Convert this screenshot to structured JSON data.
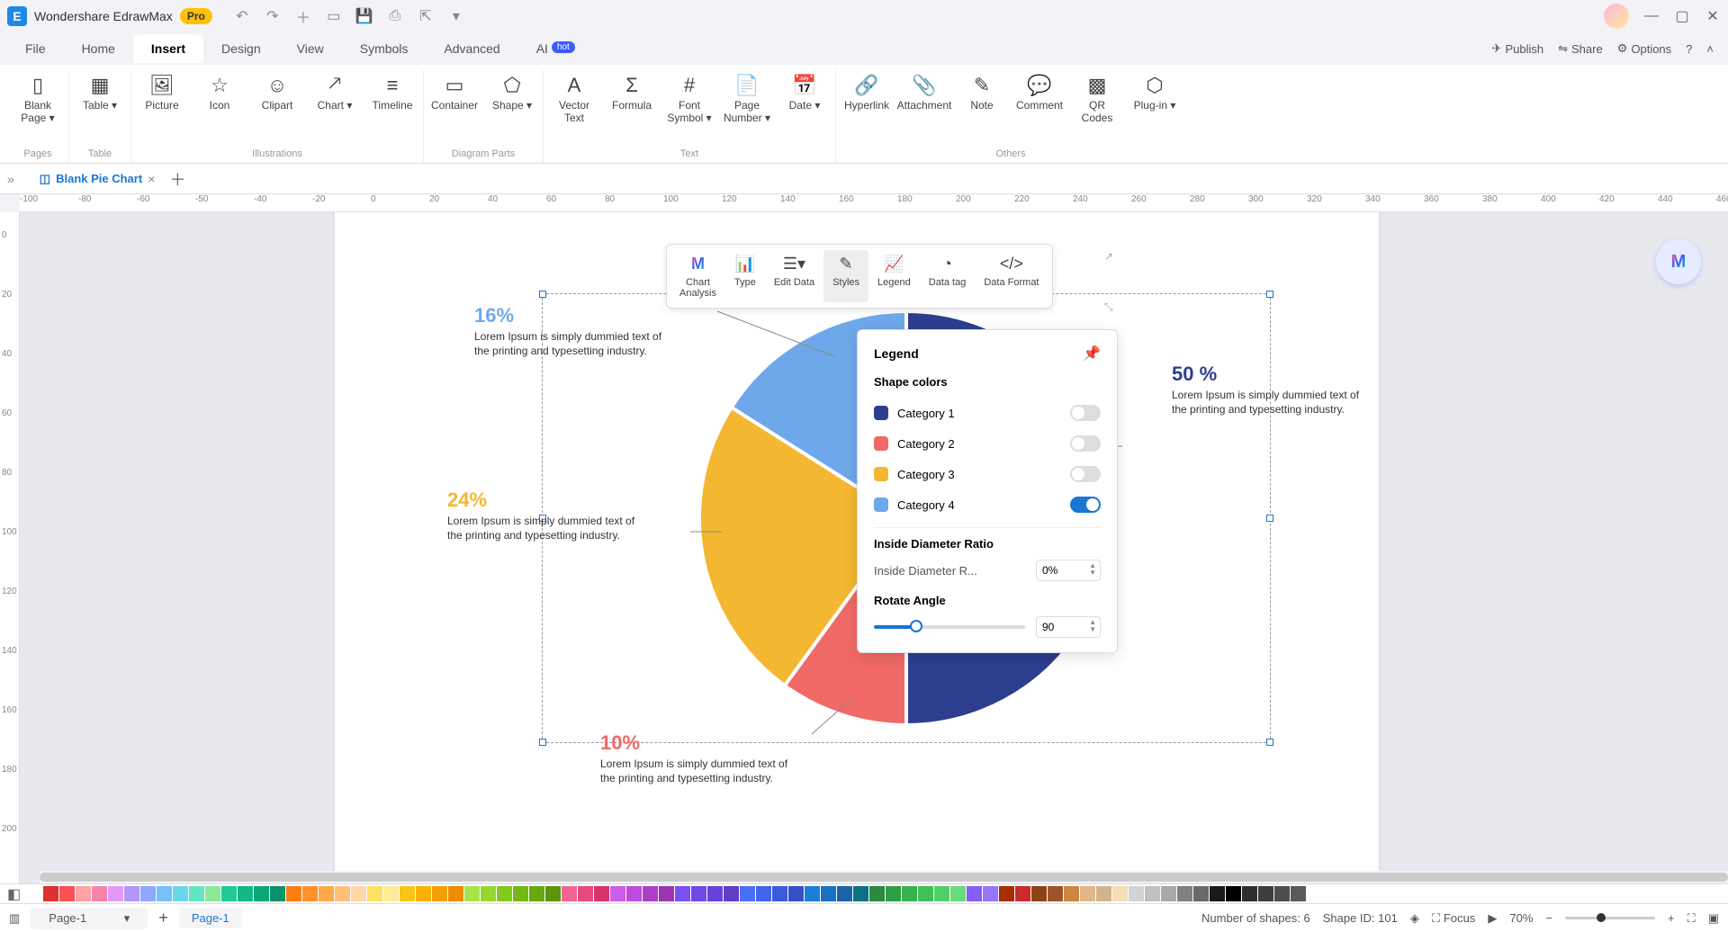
{
  "app": {
    "title": "Wondershare EdrawMax",
    "badge": "Pro"
  },
  "menu": {
    "tabs": [
      "File",
      "Home",
      "Insert",
      "Design",
      "View",
      "Symbols",
      "Advanced",
      "AI"
    ],
    "active": "Insert",
    "hot_on": "AI",
    "right": {
      "publish": "Publish",
      "share": "Share",
      "options": "Options"
    }
  },
  "ribbon": {
    "groups": [
      {
        "label": "Pages",
        "items": [
          {
            "l": "Blank\nPage",
            "arrow": true
          }
        ]
      },
      {
        "label": "Table",
        "items": [
          {
            "l": "Table",
            "arrow": true
          }
        ]
      },
      {
        "label": "Illustrations",
        "items": [
          {
            "l": "Picture"
          },
          {
            "l": "Icon"
          },
          {
            "l": "Clipart"
          },
          {
            "l": "Chart",
            "arrow": true
          },
          {
            "l": "Timeline"
          }
        ]
      },
      {
        "label": "Diagram Parts",
        "items": [
          {
            "l": "Container"
          },
          {
            "l": "Shape",
            "arrow": true
          }
        ]
      },
      {
        "label": "Text",
        "items": [
          {
            "l": "Vector\nText"
          },
          {
            "l": "Formula"
          },
          {
            "l": "Font\nSymbol",
            "arrow": true
          },
          {
            "l": "Page\nNumber",
            "arrow": true
          },
          {
            "l": "Date",
            "arrow": true
          }
        ]
      },
      {
        "label": "Others",
        "items": [
          {
            "l": "Hyperlink"
          },
          {
            "l": "Attachment"
          },
          {
            "l": "Note"
          },
          {
            "l": "Comment"
          },
          {
            "l": "QR\nCodes"
          },
          {
            "l": "Plug-in",
            "arrow": true
          }
        ]
      }
    ]
  },
  "doctab": {
    "name": "Blank Pie Chart"
  },
  "hruler_start": -100,
  "hruler_step": 20,
  "hruler_count": 80,
  "vruler_start": 0,
  "vruler_step": 20,
  "vruler_count": 12,
  "chart_data": {
    "type": "pie",
    "title": "",
    "series": [
      {
        "name": "Category 1",
        "value": 50,
        "color": "#2d3e8f"
      },
      {
        "name": "Category 2",
        "value": 10,
        "color": "#f06966"
      },
      {
        "name": "Category 3",
        "value": 24,
        "color": "#f4b731"
      },
      {
        "name": "Category 4",
        "value": 16,
        "color": "#6fa8ea"
      }
    ],
    "labels": {
      "pct50": "50 %",
      "pct10": "10%",
      "pct24": "24%",
      "pct16": "16%",
      "lorem": "Lorem Ipsum is simply dummied text of the printing and typesetting industry."
    },
    "rotate_angle": 90,
    "inside_diameter_ratio": "0%"
  },
  "float_toolbar": {
    "items": [
      "Chart\nAnalysis",
      "Type",
      "Edit Data",
      "Styles",
      "Legend",
      "Data tag",
      "Data Format"
    ],
    "active": "Styles"
  },
  "legend_panel": {
    "title": "Legend",
    "shape_colors": "Shape colors",
    "rows": [
      {
        "label": "Category 1",
        "color": "#2d3e8f",
        "on": false
      },
      {
        "label": "Category 2",
        "color": "#f06966",
        "on": false
      },
      {
        "label": "Category 3",
        "color": "#f4b731",
        "on": false
      },
      {
        "label": "Category 4",
        "color": "#6fa8ea",
        "on": true
      }
    ],
    "idr_section": "Inside Diameter Ratio",
    "idr_label": "Inside Diameter R...",
    "idr_value": "0%",
    "rotate_section": "Rotate Angle",
    "rotate_value": "90"
  },
  "palette_colors": [
    "#ffffff",
    "#e03131",
    "#fa5252",
    "#ffa3a3",
    "#f783ac",
    "#e599f7",
    "#b197fc",
    "#91a7ff",
    "#74c0fc",
    "#66d9e8",
    "#63e6be",
    "#8ce99a",
    "#20c997",
    "#12b886",
    "#0ca678",
    "#099268",
    "#fd7e14",
    "#ff922b",
    "#ffa94d",
    "#ffc078",
    "#ffd8a8",
    "#ffe066",
    "#ffec99",
    "#fcc419",
    "#fab005",
    "#f59f00",
    "#f08c00",
    "#a9e34b",
    "#94d82d",
    "#82c91e",
    "#74b816",
    "#66a80f",
    "#5c940d",
    "#f06595",
    "#e64980",
    "#d6336c",
    "#cc5de8",
    "#be4bdb",
    "#ae3ec9",
    "#9c36b5",
    "#7950f2",
    "#7048e8",
    "#6741d9",
    "#5f3dc4",
    "#4c6ef5",
    "#4263eb",
    "#3b5bdb",
    "#364fc7",
    "#1c7ed6",
    "#1971c2",
    "#1864ab",
    "#0b7285",
    "#2b8a3e",
    "#2f9e44",
    "#37b24d",
    "#40c057",
    "#51cf66",
    "#69db7c",
    "#845ef7",
    "#9775fa",
    "#a52f01",
    "#c92a2a",
    "#8b4513",
    "#a0522d",
    "#cd853f",
    "#deb887",
    "#d2b48c",
    "#f5deb3",
    "#d3d3d3",
    "#c0c0c0",
    "#a9a9a9",
    "#808080",
    "#696969",
    "#1a1a1a",
    "#000000",
    "#2e2e2e",
    "#3d3d3d",
    "#4c4c4c",
    "#5a5a5a",
    "#ffffff"
  ],
  "statusbar": {
    "page_dropdown": "Page-1",
    "page_tab": "Page-1",
    "nshapes": "Number of shapes: 6",
    "shapeid": "Shape ID: 101",
    "focus": "Focus",
    "zoom": "70%"
  }
}
